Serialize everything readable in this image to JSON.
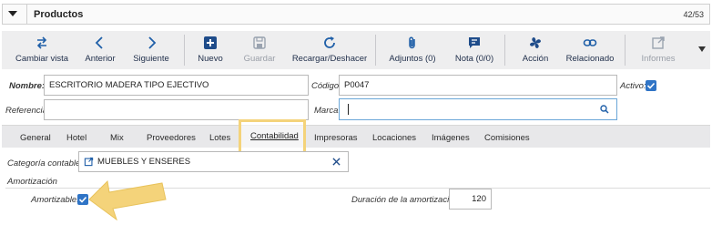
{
  "window": {
    "title": "Productos",
    "counter": "42/53"
  },
  "toolbar": {
    "buttons": [
      {
        "label": "Cambiar vista",
        "icon": "swap-arrows-icon"
      },
      {
        "label": "Anterior",
        "icon": "chevron-left-icon"
      },
      {
        "label": "Siguiente",
        "icon": "chevron-right-icon"
      },
      {
        "label": "Nuevo",
        "icon": "plus-square-icon"
      },
      {
        "label": "Guardar",
        "icon": "save-icon",
        "disabled": true
      },
      {
        "label": "Recargar/Deshacer",
        "icon": "reload-icon"
      },
      {
        "label": "Adjuntos (0)",
        "icon": "paperclip-icon"
      },
      {
        "label": "Nota (0/0)",
        "icon": "note-icon"
      },
      {
        "label": "Acción",
        "icon": "fan-icon"
      },
      {
        "label": "Relacionado",
        "icon": "link-icon"
      },
      {
        "label": "Informes",
        "icon": "external-link-icon",
        "disabled": true
      }
    ]
  },
  "form": {
    "nombre_label": "Nombre:",
    "nombre_value": "ESCRITORIO MADERA TIPO EJECTIVO",
    "codigo_label": "Código:",
    "codigo_value": "P0047",
    "activo_label": "Activo:",
    "referencia_label": "Referencia:",
    "referencia_value": "",
    "marca_label": "Marca:",
    "marca_value": ""
  },
  "tabs": [
    "General",
    "Hotel",
    "Mix",
    "Proveedores",
    "Lotes",
    "Contabilidad",
    "Impresoras",
    "Locaciones",
    "Imágenes",
    "Comisiones"
  ],
  "active_tab": "Contabilidad",
  "contabilidad": {
    "categoria_label": "Categoría contable:",
    "categoria_value": "MUEBLES Y ENSERES",
    "section_title": "Amortización",
    "amortizable_label": "Amortizable:",
    "duracion_label": "Duración de la amortización:",
    "duracion_value": "120"
  },
  "colors": {
    "accent": "#2f74c6",
    "highlight": "#f4d37a",
    "toolbar_bg": "#eeeeef"
  }
}
